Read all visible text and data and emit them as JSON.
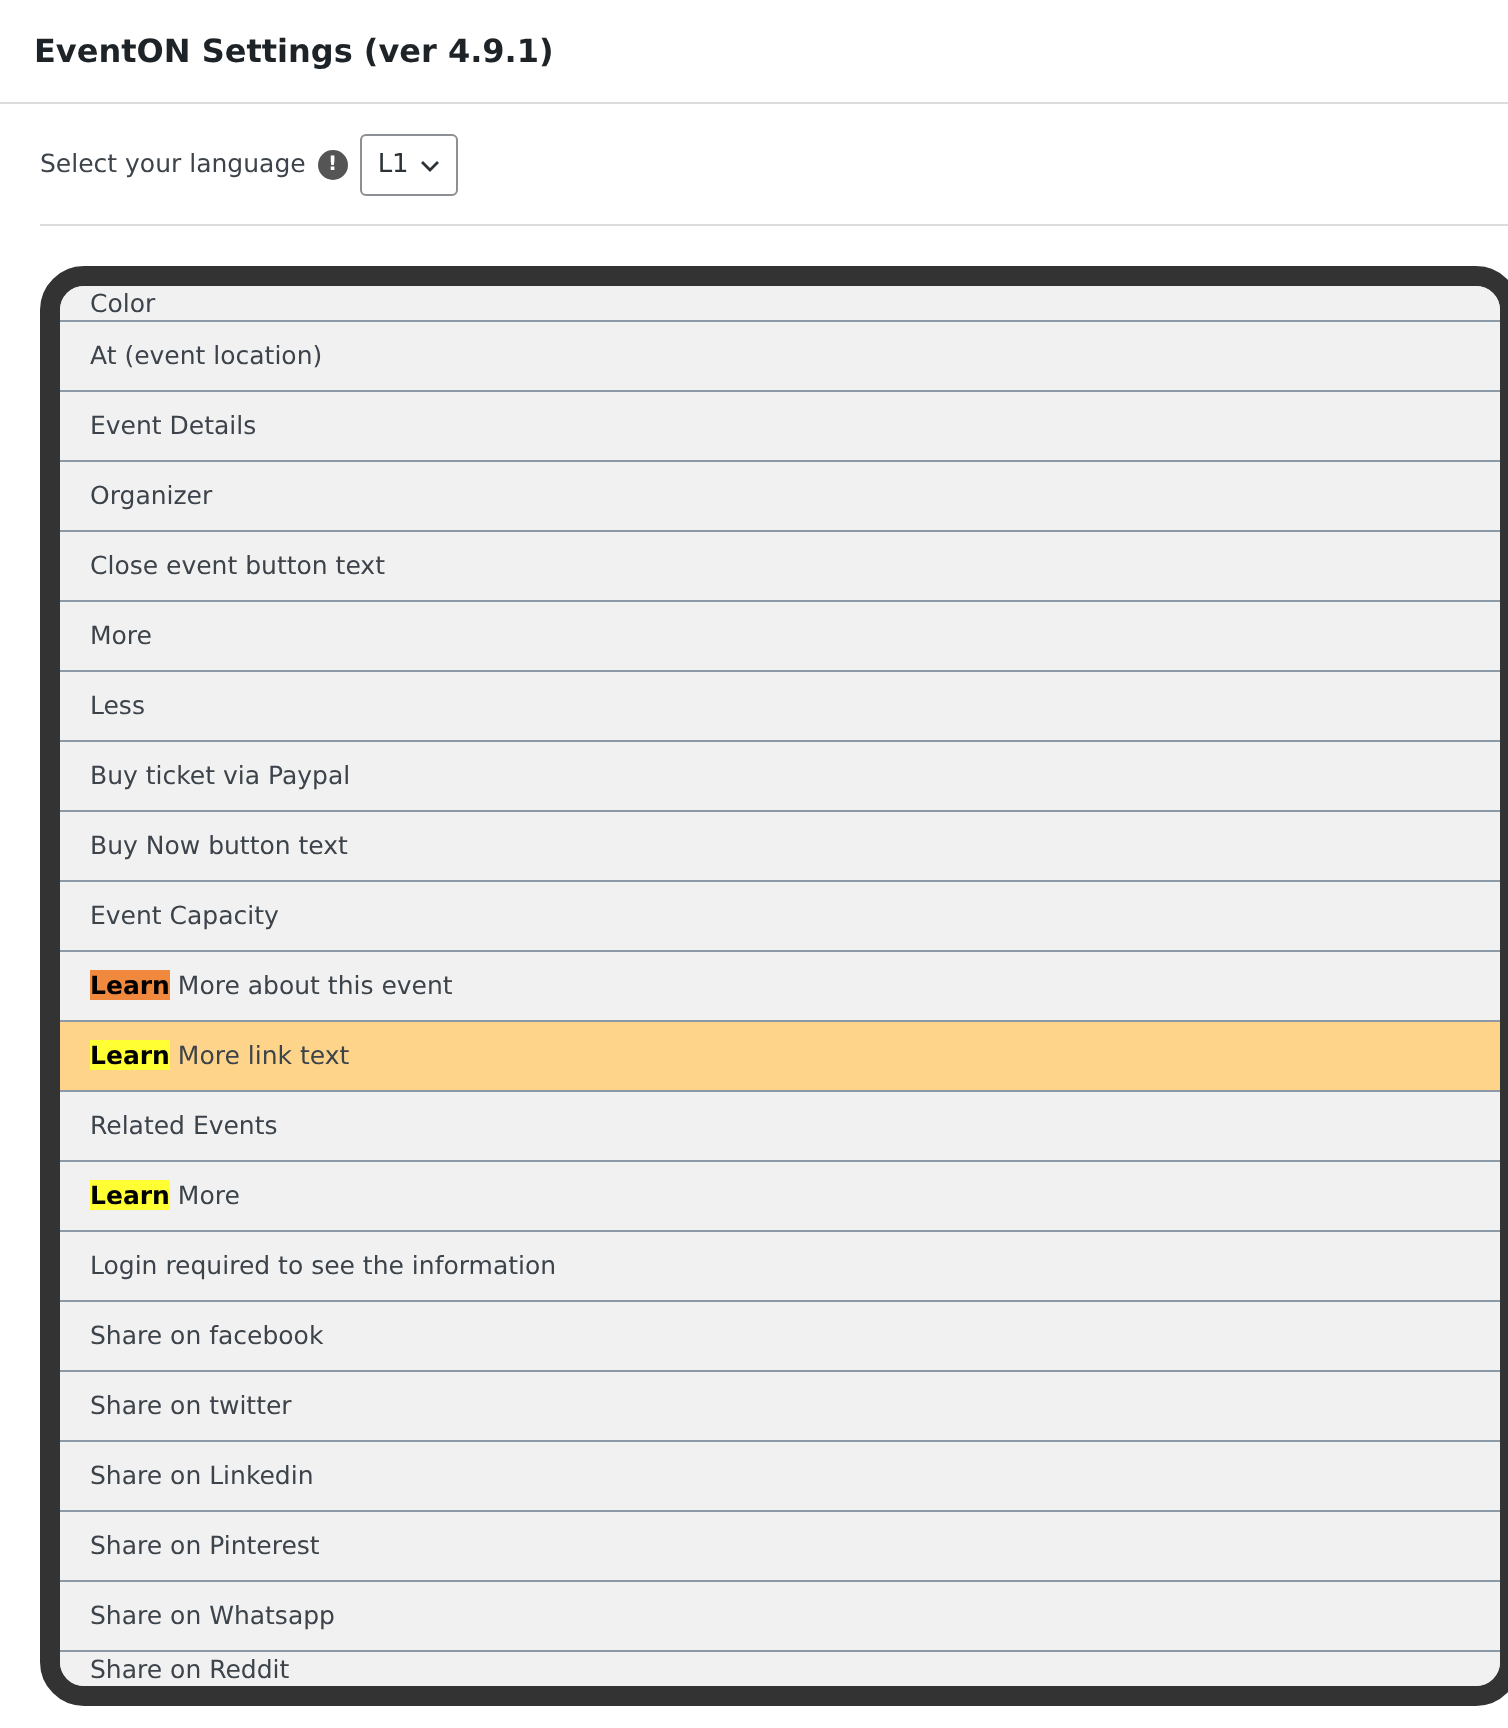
{
  "page_title": "EventON Settings (ver 4.9.1)",
  "language": {
    "label": "Select your language",
    "info_icon": "!",
    "value": "L1"
  },
  "rows": [
    {
      "text": "Color",
      "selected": false
    },
    {
      "text": "At (event location)",
      "selected": false
    },
    {
      "text": "Event Details",
      "selected": false
    },
    {
      "text": "Organizer",
      "selected": false
    },
    {
      "text": "Close event button text",
      "selected": false
    },
    {
      "text": "More",
      "selected": false
    },
    {
      "text": "Less",
      "selected": false
    },
    {
      "text": "Buy ticket via Paypal",
      "selected": false
    },
    {
      "text": "Buy Now button text",
      "selected": false
    },
    {
      "text": "Event Capacity",
      "selected": false
    },
    {
      "highlight": {
        "text": "Learn",
        "color": "#f0883e"
      },
      "text": "More about this event",
      "selected": false
    },
    {
      "highlight": {
        "text": "Learn",
        "color": "#ffff33"
      },
      "text": "More link text",
      "selected": true
    },
    {
      "text": "Related Events",
      "selected": false
    },
    {
      "highlight": {
        "text": "Learn",
        "color": "#ffff33"
      },
      "text": "More",
      "selected": false
    },
    {
      "text": "Login required to see the information",
      "selected": false
    },
    {
      "text": "Share on facebook",
      "selected": false
    },
    {
      "text": "Share on twitter",
      "selected": false
    },
    {
      "text": "Share on Linkedin",
      "selected": false
    },
    {
      "text": "Share on Pinterest",
      "selected": false
    },
    {
      "text": "Share on Whatsapp",
      "selected": false
    },
    {
      "text": "Share on Reddit",
      "selected": false
    }
  ]
}
